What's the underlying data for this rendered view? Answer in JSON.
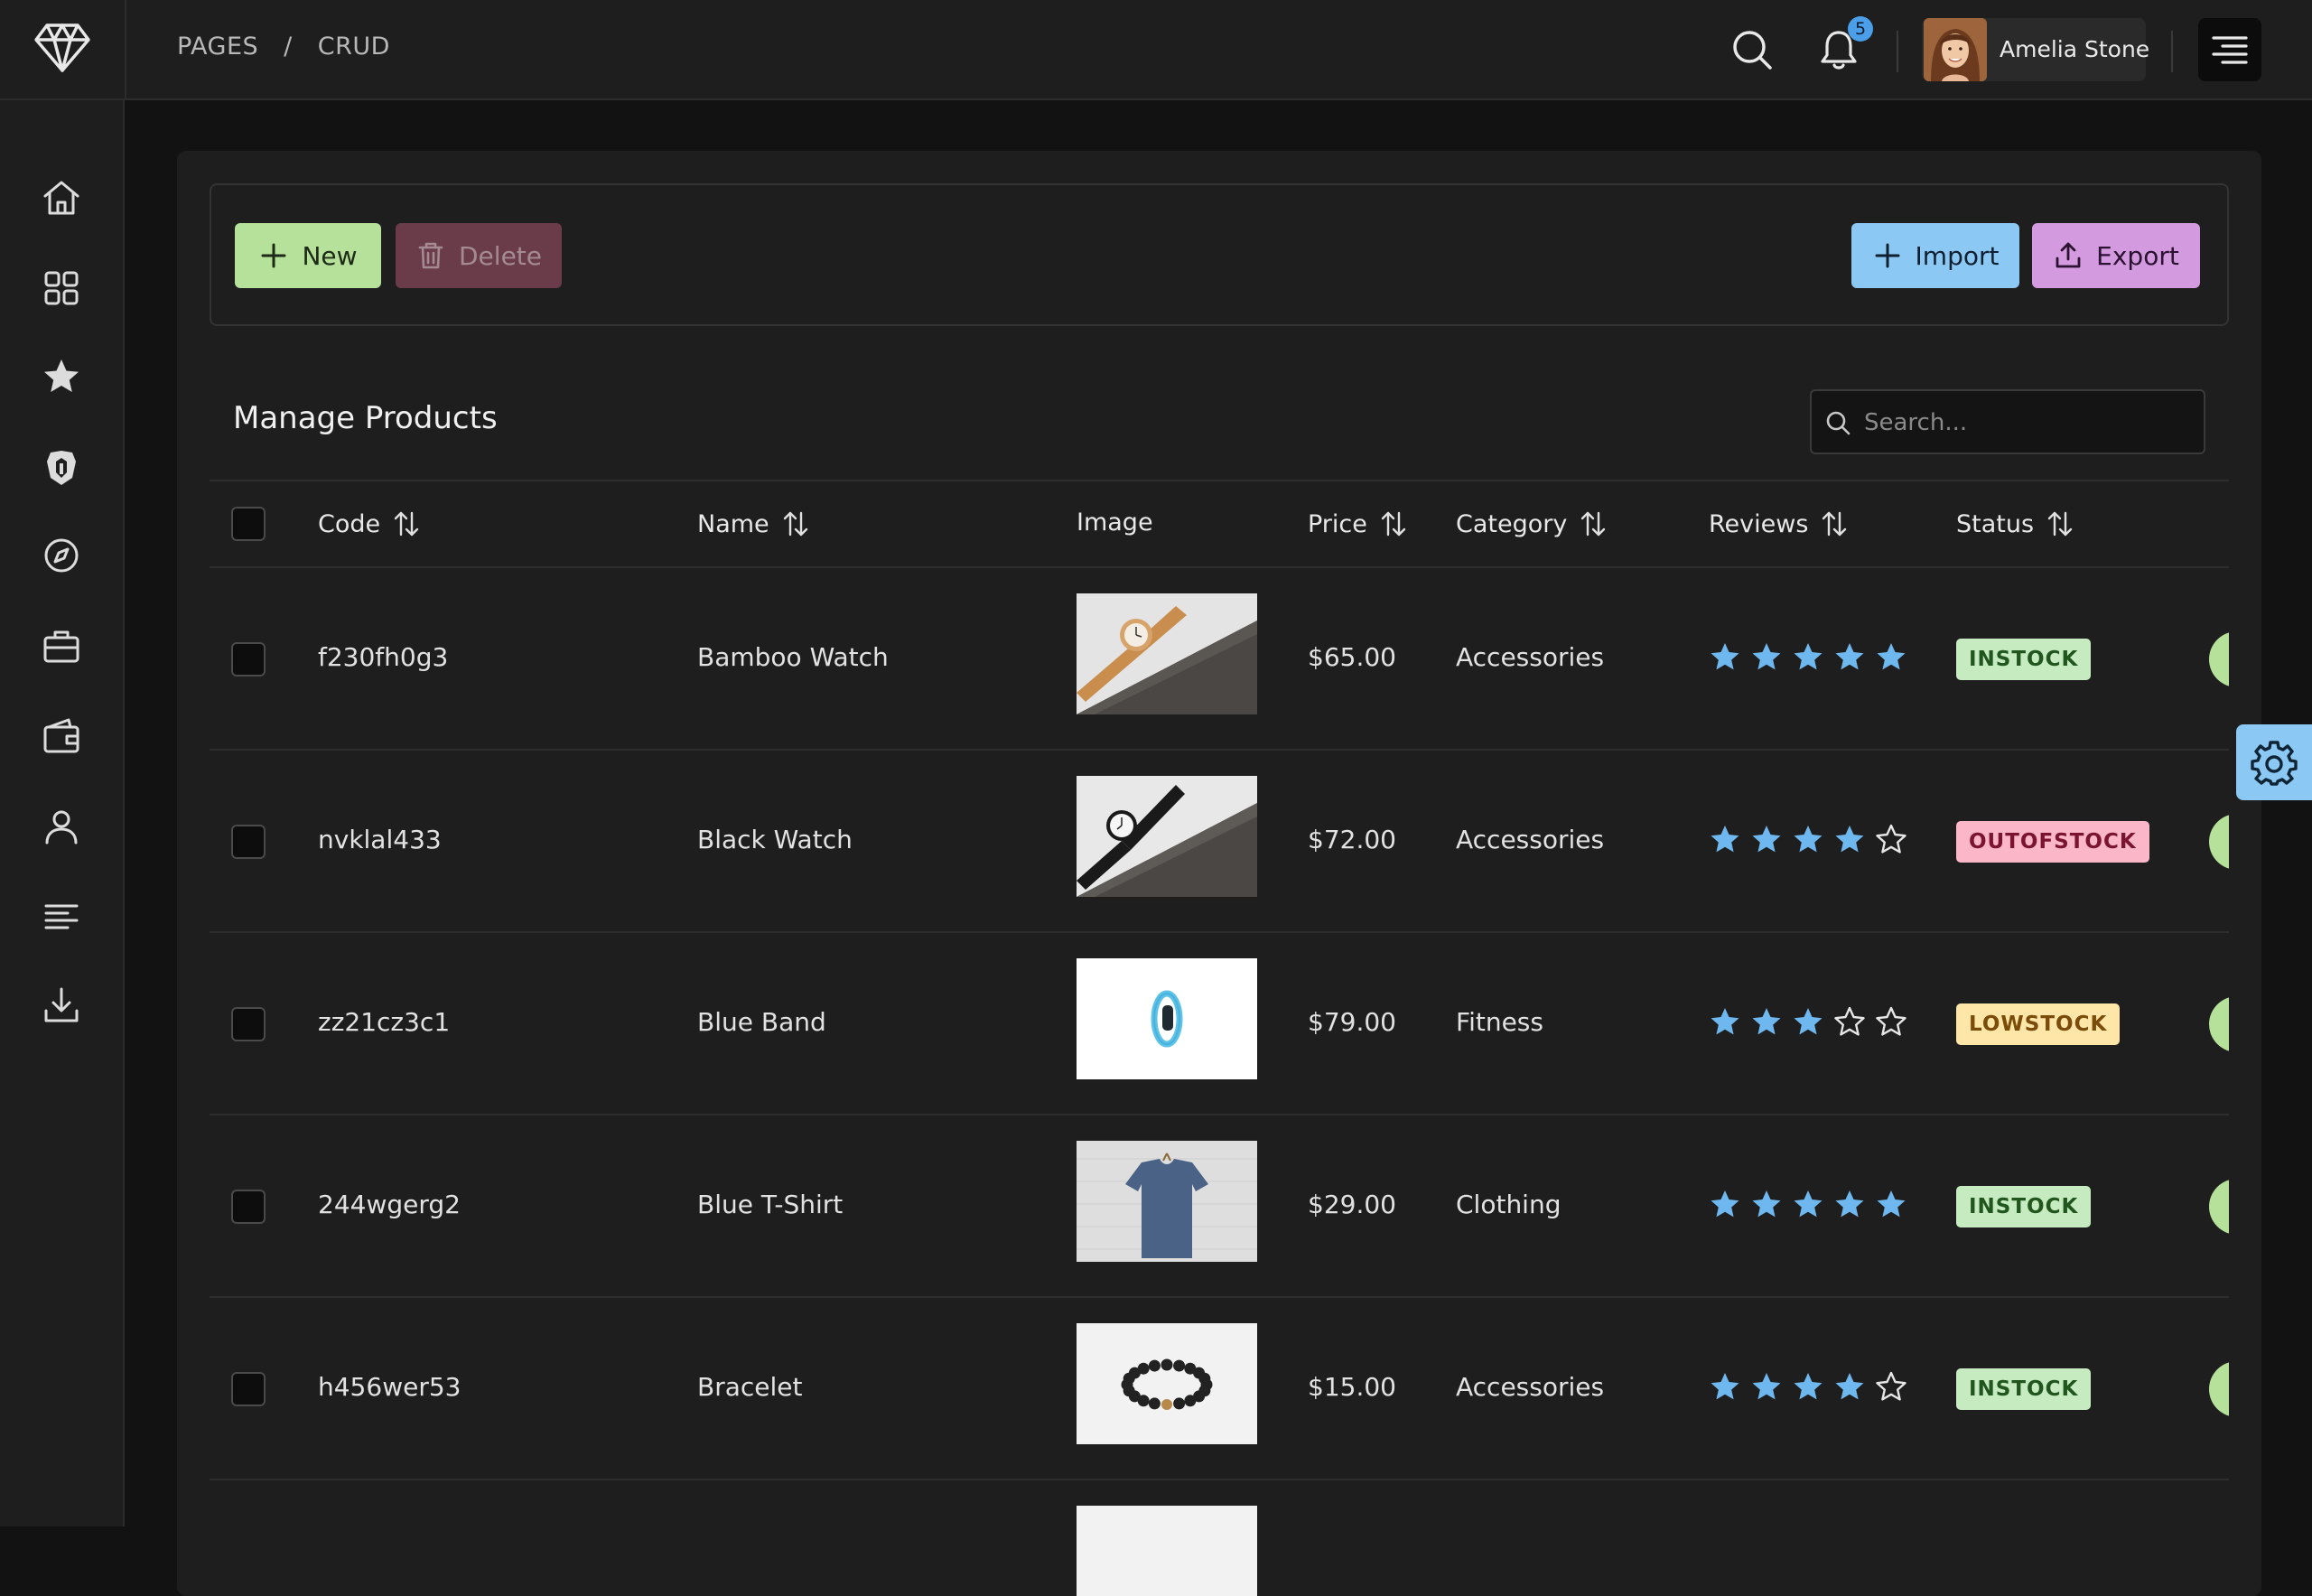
{
  "breadcrumb": {
    "root": "PAGES",
    "separator": "/",
    "current": "CRUD"
  },
  "notifications": {
    "count": "5"
  },
  "user": {
    "name": "Amelia Stone"
  },
  "toolbar": {
    "new_label": "New",
    "delete_label": "Delete",
    "import_label": "Import",
    "export_label": "Export"
  },
  "page": {
    "title": "Manage Products"
  },
  "search": {
    "placeholder": "Search..."
  },
  "table": {
    "columns": {
      "code": "Code",
      "name": "Name",
      "image": "Image",
      "price": "Price",
      "category": "Category",
      "reviews": "Reviews",
      "status": "Status"
    },
    "rows": [
      {
        "code": "f230fh0g3",
        "name": "Bamboo Watch",
        "image": "bamboo watch",
        "price": "$65.00",
        "category": "Accessories",
        "rating": 5,
        "status": "INSTOCK"
      },
      {
        "code": "nvklal433",
        "name": "Black Watch",
        "image": "black watch",
        "price": "$72.00",
        "category": "Accessories",
        "rating": 4,
        "status": "OUTOFSTOCK"
      },
      {
        "code": "zz21cz3c1",
        "name": "Blue Band",
        "image": "blue fitness band",
        "price": "$79.00",
        "category": "Fitness",
        "rating": 3,
        "status": "LOWSTOCK"
      },
      {
        "code": "244wgerg2",
        "name": "Blue T-Shirt",
        "image": "blue t-shirt",
        "price": "$29.00",
        "category": "Clothing",
        "rating": 5,
        "status": "INSTOCK"
      },
      {
        "code": "h456wer53",
        "name": "Bracelet",
        "image": "beaded bracelet",
        "price": "$15.00",
        "category": "Accessories",
        "rating": 4,
        "status": "INSTOCK"
      }
    ]
  },
  "colors": {
    "accent_blue": "#8cc8f4",
    "new_green": "#b6e19a",
    "delete_red": "#6a3c49",
    "export_purple": "#d39ae0",
    "star_filled": "#6fb8ef",
    "instock": "#c7ebc0",
    "outofstock": "#fbb6c8",
    "lowstock": "#fde6a8"
  },
  "icons": {
    "logo": "diamond-logo",
    "search": "search-icon",
    "bell": "bell-icon",
    "menu": "menu-icon",
    "sidebar": [
      "home-icon",
      "grid-icon",
      "star-icon",
      "prime-icon",
      "compass-icon",
      "briefcase-icon",
      "wallet-icon",
      "user-icon",
      "align-left-icon",
      "download-icon"
    ],
    "config": "gear-icon"
  }
}
